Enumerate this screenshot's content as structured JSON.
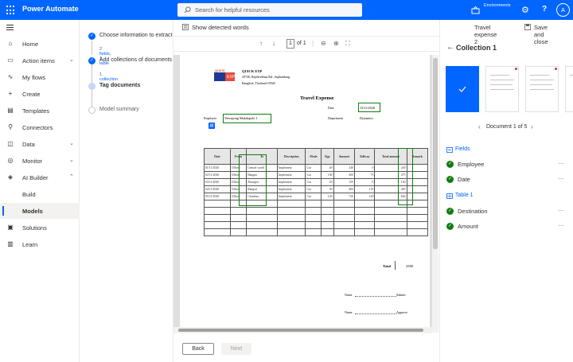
{
  "app": {
    "title": "Power Automate",
    "environments_label": "Environments",
    "avatar": "A"
  },
  "search": {
    "placeholder": "Search for helpful resources"
  },
  "nav": [
    {
      "label": "Home",
      "icon": "home-icon",
      "chevron": false
    },
    {
      "label": "Action items",
      "icon": "clipboard-icon",
      "chevron": true
    },
    {
      "label": "My flows",
      "icon": "flow-icon",
      "chevron": false
    },
    {
      "label": "Create",
      "icon": "plus-icon",
      "chevron": false
    },
    {
      "label": "Templates",
      "icon": "template-icon",
      "chevron": false
    },
    {
      "label": "Connectors",
      "icon": "connector-icon",
      "chevron": false
    },
    {
      "label": "Data",
      "icon": "database-icon",
      "chevron": true
    },
    {
      "label": "Monitor",
      "icon": "monitor-icon",
      "chevron": true
    },
    {
      "label": "AI Builder",
      "icon": "ai-builder-icon",
      "chevron": true
    },
    {
      "label": "Build",
      "icon": "",
      "chevron": false
    },
    {
      "label": "Models",
      "icon": "",
      "chevron": false,
      "selected": true
    },
    {
      "label": "Solutions",
      "icon": "solutions-icon",
      "chevron": false
    },
    {
      "label": "Learn",
      "icon": "book-icon",
      "chevron": false
    }
  ],
  "steps": [
    {
      "title": "Choose information to extract",
      "sub": "2 fields, 1 table",
      "state": "done"
    },
    {
      "title": "Add collections of documents",
      "sub": "1 collection",
      "state": "done"
    },
    {
      "title": "Tag documents",
      "sub": "",
      "state": "current"
    },
    {
      "title": "Model summary",
      "sub": "",
      "state": "todo"
    }
  ],
  "viewer": {
    "show_detected": "Show detected words",
    "doc_name": "Travel expense 2",
    "save_close": "Save and close",
    "page_current": "1",
    "page_of": "of 1"
  },
  "document": {
    "logo_text": "QUICK EXP",
    "company": "QUICK EXP",
    "address1": "29740, Rajthevkhna Rd., Suphanburg",
    "address2": "Bangkok, Thailand 10540",
    "title": "Travel Expense",
    "date_label": "Date",
    "date_value": "15/11/2020",
    "employee_label": "Employee",
    "employee_value": "Veerapong Mukdapolo 1",
    "department_label": "Department",
    "department_value": "Dynamics",
    "headers": [
      "Date",
      "From",
      "To",
      "Description",
      "Mode",
      "Kgs",
      "Amount",
      "Tollway",
      "Total amount",
      "Remark"
    ],
    "rows": [
      [
        "01/11/2020",
        "Office",
        "Central world",
        "Implement",
        "Car",
        "40",
        "240",
        "0",
        "240",
        ""
      ],
      [
        "02/11/2020",
        "Office",
        "Bangna",
        "Implement",
        "Car",
        "100",
        "400",
        "75",
        "475",
        ""
      ],
      [
        "03/11/2020",
        "Office",
        "Thonglor",
        "Implement",
        "Car",
        "20",
        "150",
        "0",
        "150",
        ""
      ],
      [
        "04/11/2020",
        "Office",
        "Rangsit",
        "Implement",
        "Car",
        "30",
        "400",
        "170",
        "405",
        ""
      ],
      [
        "05/11/2020",
        "Office",
        "Chonburi",
        "Implement",
        "Car",
        "120",
        "720",
        "120",
        "840",
        ""
      ]
    ],
    "total_label": "Total",
    "total_value": "2580",
    "name_label1": "Name",
    "submit_label": "Submit",
    "name_label2": "Name",
    "approve_label": "Approve"
  },
  "buttons": {
    "back": "Back",
    "next": "Next"
  },
  "collection": {
    "title": "Collection 1",
    "doc_nav": "Document 1 of 5",
    "fields_label": "Fields",
    "table_label": "Table 1",
    "fields": [
      {
        "label": "Employee"
      },
      {
        "label": "Date"
      }
    ],
    "table_fields": [
      {
        "label": "Destination"
      },
      {
        "label": "Amount"
      }
    ]
  }
}
